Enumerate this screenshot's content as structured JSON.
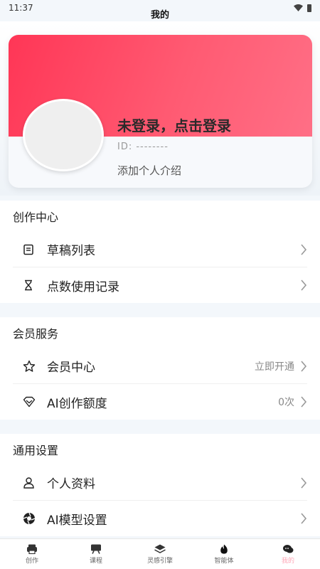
{
  "status_bar": {
    "time": "11:37"
  },
  "title": "我的",
  "profile": {
    "login_text": "未登录，点击登录",
    "id_text": "ID: --------",
    "bio": "添加个人介绍"
  },
  "sections": {
    "creation": {
      "title": "创作中心",
      "items": [
        {
          "label": "草稿列表",
          "icon": "document-icon"
        },
        {
          "label": "点数使用记录",
          "icon": "hourglass-icon"
        }
      ]
    },
    "membership": {
      "title": "会员服务",
      "items": [
        {
          "label": "会员中心",
          "value": "立即开通",
          "icon": "star-icon"
        },
        {
          "label": "AI创作额度",
          "value": "0次",
          "icon": "diamond-icon"
        }
      ]
    },
    "settings": {
      "title": "通用设置",
      "items": [
        {
          "label": "个人资料",
          "icon": "person-icon"
        },
        {
          "label": "AI模型设置",
          "icon": "aperture-icon"
        }
      ]
    }
  },
  "bottom_nav": {
    "items": [
      {
        "label": "创作",
        "icon": "printer-icon"
      },
      {
        "label": "课程",
        "icon": "board-icon"
      },
      {
        "label": "灵感引擎",
        "icon": "layers-icon"
      },
      {
        "label": "智能体",
        "icon": "flame-icon"
      },
      {
        "label": "我的",
        "icon": "chat-icon",
        "active": true
      }
    ]
  },
  "colors": {
    "accent": "#ff4d6d",
    "banner_start": "#ff3656",
    "banner_end": "#ff6f86"
  }
}
